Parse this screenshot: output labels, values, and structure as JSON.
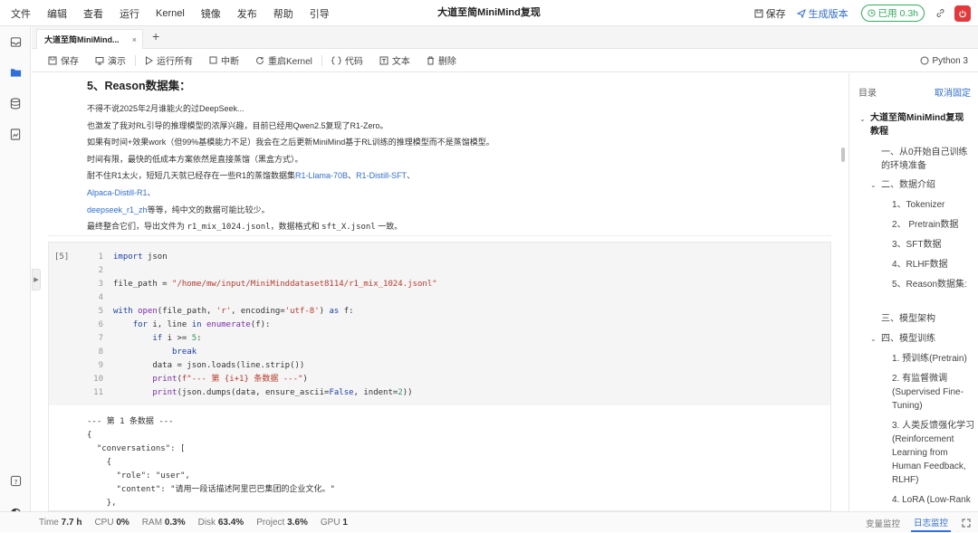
{
  "menu": [
    "文件",
    "编辑",
    "查看",
    "运行",
    "Kernel",
    "镜像",
    "发布",
    "帮助",
    "引导"
  ],
  "window_title": "大道至简MiniMind复现",
  "top_right": {
    "save": "保存",
    "generate": "生成版本",
    "usage": "已用 0.3h"
  },
  "tab": {
    "label": "大道至简MiniMind...",
    "close": "×",
    "add": "+"
  },
  "toolbar": {
    "save": "保存",
    "present": "演示",
    "run_all": "运行所有",
    "interrupt": "中断",
    "restart": "重启Kernel",
    "code": "代码",
    "text": "文本",
    "delete": "删除",
    "kernel": "Python 3"
  },
  "markdown": {
    "heading": "5、Reason数据集：",
    "p1": "不得不说2025年2月谁能火的过DeepSeek...",
    "p2": "也激发了我对RL引导的推理模型的浓厚兴趣，目前已经用Qwen2.5复现了R1-Zero。",
    "p3": "如果有时间+效果work（但99%基模能力不足）我会在之后更新MiniMind基于RL训练的推理模型而不是蒸馏模型。",
    "p4": "时间有限，最快的低成本方案依然是直接蒸馏（黑盒方式）。",
    "p5_pre": "耐不住R1太火，短短几天就已经存在一些R1的蒸馏数据集",
    "link1": "R1-Llama-70B",
    "sep1": "、",
    "link2": "R1-Distill-SFT",
    "sep2": "、",
    "link3": "Alpaca-Distill-R1",
    "sep3": "、",
    "link4": "deepseek_r1_zh",
    "p6_post": "等等，纯中文的数据可能比较少。",
    "p7_pre": "最终整合它们，导出文件为 ",
    "p7_code1": "r1_mix_1024.jsonl",
    "p7_mid": "，数据格式和 ",
    "p7_code2": "sft_X.jsonl",
    "p7_post": " 一致。"
  },
  "cell": {
    "prompt": "[5]",
    "line_numbers": [
      "1",
      "2",
      "3",
      "4",
      "5",
      "6",
      "7",
      "8",
      "9",
      "10",
      "11"
    ],
    "output": "--- 第 1 条数据 ---\n{\n  \"conversations\": [\n    {\n      \"role\": \"user\",\n      \"content\": \"请用一段话描述阿里巴巴集团的企业文化。\"\n    },"
  },
  "toc": {
    "title": "目录",
    "cancel": "取消固定",
    "root": "大道至简MiniMind复现教程",
    "s1": "一、从0开始自己训练的环境准备",
    "s2": "二、数据介绍",
    "s2_1": "1、Tokenizer",
    "s2_2": "2、 Pretrain数据",
    "s2_3": "3、SFT数据",
    "s2_4": "4、RLHF数据",
    "s2_5": "5、Reason数据集:",
    "s3": "三、模型架构",
    "s4": "四、模型训练",
    "s4_1": "1. 预训练(Pretrain)",
    "s4_2": "2. 有监督微调(Supervised Fine-Tuning)",
    "s4_3": "3. 人类反馈强化学习(Reinforcement Learning from Human Feedback, RLHF)",
    "s4_4": "4. LoRA (Low-Rank"
  },
  "status": {
    "time_label": "Time",
    "time": "7.7 h",
    "cpu_label": "CPU",
    "cpu": "0%",
    "ram_label": "RAM",
    "ram": "0.3%",
    "disk_label": "Disk",
    "disk": "63.4%",
    "project_label": "Project",
    "project": "3.6%",
    "gpu_label": "GPU",
    "gpu": "1",
    "var_monitor": "变量监控",
    "log_monitor": "日志监控"
  },
  "colors": {
    "accent": "#2f6fde",
    "usage_green": "#2db15b",
    "danger": "#e5383b"
  }
}
